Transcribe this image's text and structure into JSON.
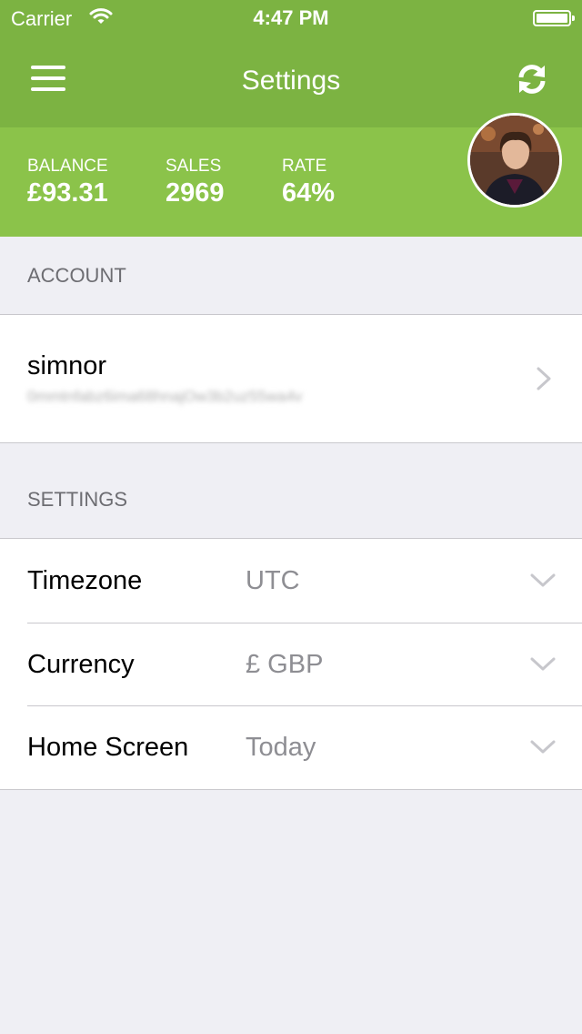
{
  "status_bar": {
    "carrier": "Carrier",
    "time": "4:47 PM",
    "wifi_icon": "wifi-icon",
    "battery_icon": "battery-icon"
  },
  "nav": {
    "title": "Settings",
    "menu_icon": "hamburger-menu-icon",
    "refresh_icon": "refresh-icon"
  },
  "stats": {
    "balance_label": "BALANCE",
    "balance_value": "£93.31",
    "sales_label": "SALES",
    "sales_value": "2969",
    "rate_label": "RATE",
    "rate_value": "64%"
  },
  "account": {
    "header": "ACCOUNT",
    "username": "simnor",
    "api_key": "0mmtnfabz6ima68hnajOw3b2uz55wa4v"
  },
  "settings": {
    "header": "SETTINGS",
    "rows": [
      {
        "label": "Timezone",
        "value": "UTC"
      },
      {
        "label": "Currency",
        "value": "£ GBP"
      },
      {
        "label": "Home Screen",
        "value": "Today"
      }
    ]
  },
  "colors": {
    "nav_green": "#7cb342",
    "stats_green": "#8bc34a",
    "background": "#efeff4"
  }
}
